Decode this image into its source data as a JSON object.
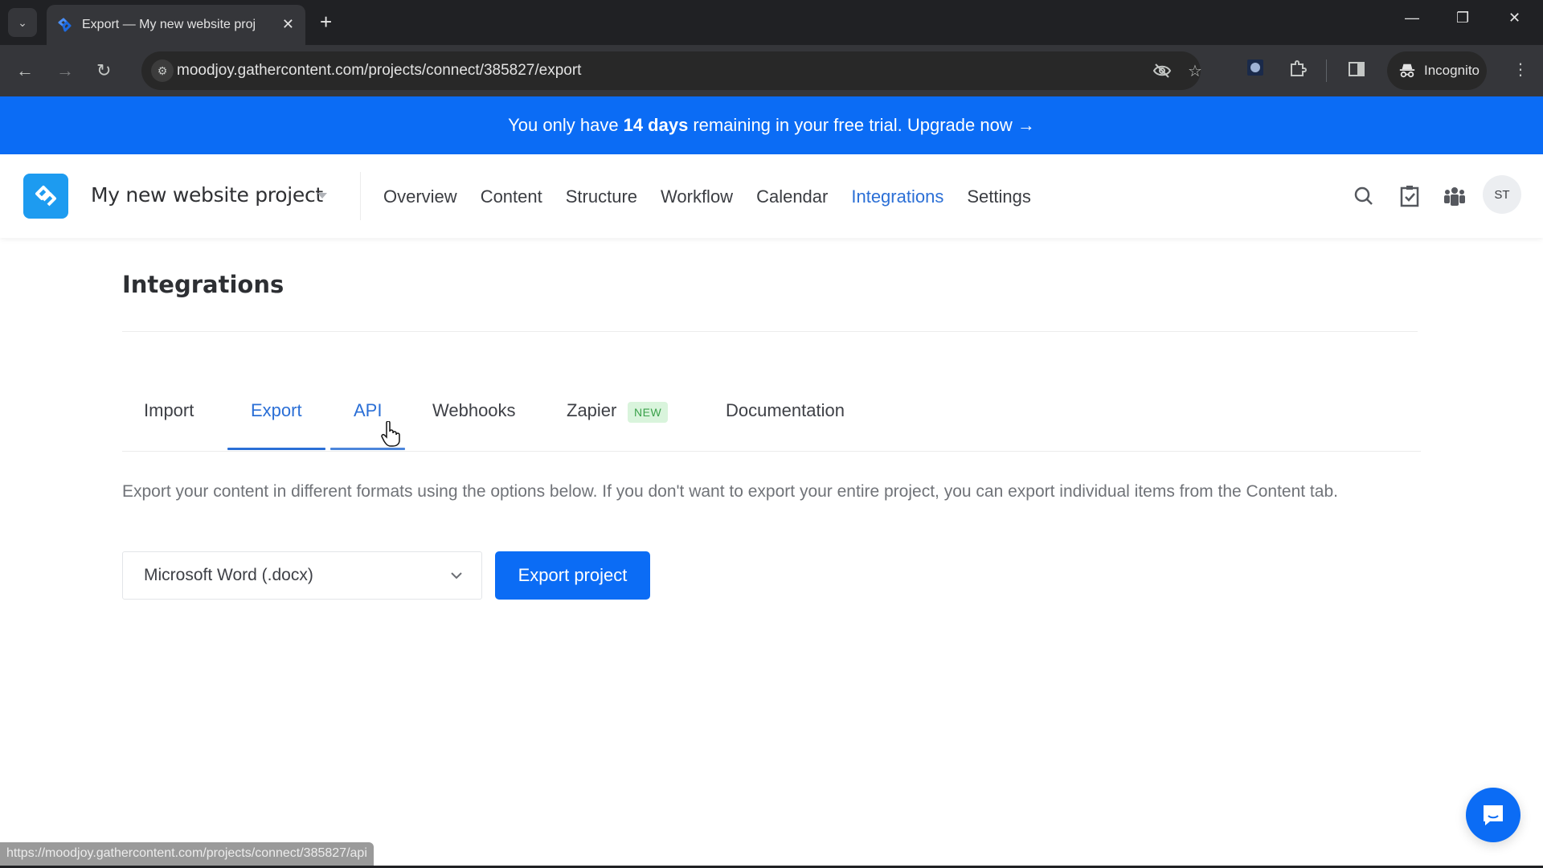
{
  "browser": {
    "tab_title": "Export — My new website proj",
    "url": "moodjoy.gathercontent.com/projects/connect/385827/export",
    "profile_label": "Incognito",
    "status_url": "https://moodjoy.gathercontent.com/projects/connect/385827/api"
  },
  "banner": {
    "text_before": "You only have",
    "highlight": "14 days",
    "text_after": "remaining in your free trial. Upgrade now →"
  },
  "header": {
    "project_name": "My new website project",
    "nav": [
      {
        "label": "Overview",
        "active": false
      },
      {
        "label": "Content",
        "active": false
      },
      {
        "label": "Structure",
        "active": false
      },
      {
        "label": "Workflow",
        "active": false
      },
      {
        "label": "Calendar",
        "active": false
      },
      {
        "label": "Integrations",
        "active": true
      },
      {
        "label": "Settings",
        "active": false
      }
    ],
    "icons": [
      "search-icon",
      "tasks-icon",
      "team-icon"
    ],
    "avatar_initials": "ST"
  },
  "page": {
    "title": "Integrations",
    "tabs": [
      {
        "label": "Import"
      },
      {
        "label": "Export",
        "active": true
      },
      {
        "label": "API",
        "hovered": true
      },
      {
        "label": "Webhooks"
      },
      {
        "label": "Zapier",
        "badge": "NEW"
      },
      {
        "label": "Documentation"
      }
    ],
    "description": "Export your content in different formats using the options below. If you don't want to export your entire project, you can export individual items from the Content tab.",
    "format_select": {
      "selected": "Microsoft Word (.docx)"
    },
    "export_button": "Export project"
  },
  "colors": {
    "brand_blue": "#0b6cf5",
    "active_link": "#2b6fd6",
    "badge_green": "#3aa14a"
  }
}
